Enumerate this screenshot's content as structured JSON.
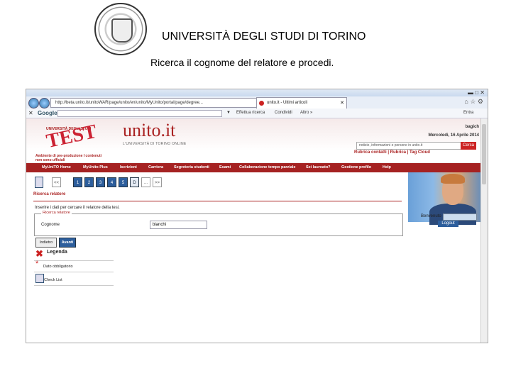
{
  "slide": {
    "title": "UNIVERSITÀ DEGLI STUDI DI TORINO",
    "subtitle": "Ricerca il cognome del relatore e procedi."
  },
  "browser": {
    "url": "http://beta.unito.it/unitoWAR/page/unito/en/unito/MyUnito/portal/page/degree...",
    "tab_label": "unito.it - Ultimi articoli",
    "google_label": "Google",
    "toolbar_items": [
      "Effettua ricerca",
      "Condividi",
      "Altro »"
    ],
    "toolbar_right": "Entra"
  },
  "site": {
    "test_stamp": "TEST",
    "small_uni": "UNIVERSITÀ DEGLI STUDI",
    "ambiente": "Ambiente di pre-produzione I contenuti non sono ufficiali",
    "logo": "unito.it",
    "logo_sub": "L'UNIVERSITÀ DI TORINO ONLINE",
    "user_name": "bagich",
    "date": "Mercoledì, 16 Aprile 2014",
    "search_placeholder": "notizie, informazioni e persone in unito.it",
    "search_button": "Cerca",
    "top_links": "Rubrica contatti | Rubrica | Tag Cloud",
    "menu": [
      "MyUniTO Home",
      "MyUnito Plus",
      "Iscrizioni",
      "Carriera",
      "Segreteria studenti",
      "Esami",
      "Collaborazione tempo parziale",
      "Sei laureato?",
      "Gestione profilo",
      "Help"
    ]
  },
  "wizard": {
    "steps": [
      "<<",
      "1",
      "2",
      "3",
      "4",
      "5",
      "D",
      "...",
      ">>"
    ],
    "section_title": "Ricerca relatore",
    "instructions": "Inserire i dati per cercare il relatore della tesi.",
    "fieldset_legend": "Ricerca relatore",
    "cognome_label": "Cognome",
    "cognome_value": "bianchi",
    "back_button": "Indietro",
    "next_button": "Avanti"
  },
  "legend": {
    "title": "Legenda",
    "mandatory": "Dato obbligatorio",
    "checklist": "Check List"
  },
  "profile": {
    "benvenuto": "Benvenuto",
    "logout": "Logout"
  },
  "colors": {
    "brand_red": "#a52222",
    "blue_button": "#2d5e9c"
  }
}
